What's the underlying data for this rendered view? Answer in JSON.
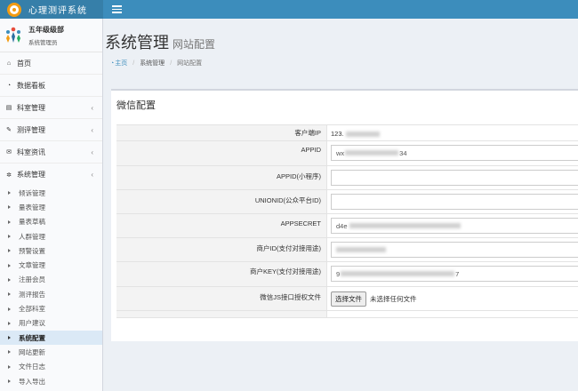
{
  "app": {
    "title": "心理测评系统"
  },
  "user": {
    "name": "五年级级部",
    "role": "系统管理员"
  },
  "sidebar": {
    "items": [
      {
        "label": "首页",
        "icon": "home-icon",
        "glyph": "⌂",
        "has_arrow": false
      },
      {
        "label": "数据看板",
        "icon": "dashboard-icon",
        "glyph": "◔",
        "has_arrow": false
      },
      {
        "label": "科室管理",
        "icon": "table-icon",
        "glyph": "▤",
        "has_arrow": true
      },
      {
        "label": "测评管理",
        "icon": "edit-icon",
        "glyph": "✎",
        "has_arrow": true
      },
      {
        "label": "科室资讯",
        "icon": "envelope-icon",
        "glyph": "✉",
        "has_arrow": true
      },
      {
        "label": "系统管理",
        "icon": "gear-icon",
        "glyph": "✲",
        "has_arrow": true
      }
    ],
    "arrow": "‹",
    "sub_items": [
      "倾诉管理",
      "量表管理",
      "量表草稿",
      "人群管理",
      "预警设置",
      "文章管理",
      "注册会员",
      "测评报告",
      "全部科室",
      "用户建议",
      "系统配置",
      "网站更新",
      "文件日志",
      "导入导出"
    ],
    "active_sub": "系统配置"
  },
  "page": {
    "title": "系统管理",
    "subtitle": "网站配置"
  },
  "breadcrumb": {
    "home": "主页",
    "section": "系统管理",
    "current": "网站配置"
  },
  "panel": {
    "title": "微信配置"
  },
  "form": {
    "client_ip_label": "客户端IP",
    "client_ip_value": "123.",
    "appid_label": "APPID",
    "appid_prefix": "wx",
    "appid_suffix": "34",
    "appid_mini_label": "APPID(小程序)",
    "unionid_label": "UNIONID(公众平台ID)",
    "appsecret_label": "APPSECRET",
    "appsecret_prefix": "d4e",
    "merchant_id_label": "商户ID(支付对接用途)",
    "merchant_key_label": "商户KEY(支付对接用途)",
    "merchant_key_prefix": "9",
    "merchant_key_suffix": "7",
    "js_file_label": "微信JS接口授权文件",
    "file_button": "选择文件",
    "file_none": "未选择任何文件"
  }
}
